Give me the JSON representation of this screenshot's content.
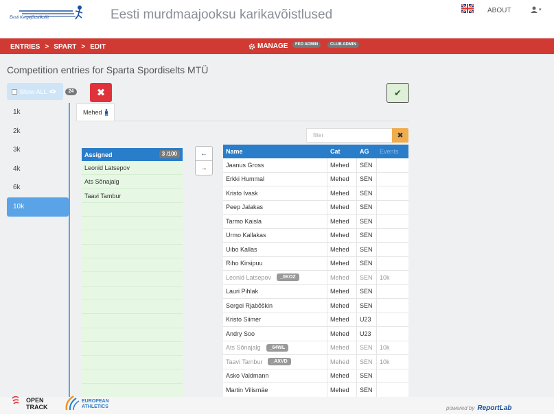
{
  "header": {
    "logo_caption": "Eesti Kergejõustikuliit",
    "title": "Eesti murdmaajooksu karikavõistlused",
    "about": "ABOUT",
    "user_caret": "▾"
  },
  "nav": {
    "crumbs": [
      "ENTRIES",
      "SPART",
      "EDIT"
    ],
    "sep": ">",
    "manage": "MANAGE",
    "badges": [
      "FED ADMIN",
      "CLUB ADMIN"
    ]
  },
  "page": {
    "heading": "Competition entries for Sparta Spordiselts MTÜ",
    "show_all": "Show ALL",
    "count": "24",
    "delete_glyph": "✖",
    "confirm_glyph": "✔"
  },
  "distances": [
    {
      "label": "1k",
      "active": false
    },
    {
      "label": "2k",
      "active": false
    },
    {
      "label": "3k",
      "active": false
    },
    {
      "label": "4k",
      "active": false
    },
    {
      "label": "6k",
      "active": false
    },
    {
      "label": "10k",
      "active": true
    }
  ],
  "tab": {
    "label": "Mehed"
  },
  "filter": {
    "placeholder": "filter",
    "button": "✖"
  },
  "assigned": {
    "header": "Assigned",
    "capacity": "3 /100",
    "rows": [
      "Leonid Latsepov",
      "Ats Sõnajalg",
      "Taavi Tambur",
      "",
      "",
      "",
      "",
      "",
      "",
      "",
      "",
      "",
      "",
      "",
      "",
      "",
      ""
    ]
  },
  "arrows": {
    "left": "←",
    "right": "→"
  },
  "table": {
    "columns": [
      "Name",
      "Cat",
      "AG",
      "Events"
    ],
    "rows": [
      {
        "name": "Jaanus Gross",
        "tag": "",
        "cat": "Mehed",
        "ag": "SEN",
        "events": "",
        "dim": false
      },
      {
        "name": "Erkki Hummal",
        "tag": "",
        "cat": "Mehed",
        "ag": "SEN",
        "events": "",
        "dim": false
      },
      {
        "name": "Kristo Ivask",
        "tag": "",
        "cat": "Mehed",
        "ag": "SEN",
        "events": "",
        "dim": false
      },
      {
        "name": "Peep Jalakas",
        "tag": "",
        "cat": "Mehed",
        "ag": "SEN",
        "events": "",
        "dim": false
      },
      {
        "name": "Tarmo Kaisla",
        "tag": "",
        "cat": "Mehed",
        "ag": "SEN",
        "events": "",
        "dim": false
      },
      {
        "name": "Urmo Kallakas",
        "tag": "",
        "cat": "Mehed",
        "ag": "SEN",
        "events": "",
        "dim": false
      },
      {
        "name": "Uibo Kallas",
        "tag": "",
        "cat": "Mehed",
        "ag": "SEN",
        "events": "",
        "dim": false
      },
      {
        "name": "Riho Kirsipuu",
        "tag": "",
        "cat": "Mehed",
        "ag": "SEN",
        "events": "",
        "dim": false
      },
      {
        "name": "Leonid Latsepov",
        "tag": "_0KOZ",
        "cat": "Mehed",
        "ag": "SEN",
        "events": "10k",
        "dim": true
      },
      {
        "name": "Lauri Pihlak",
        "tag": "",
        "cat": "Mehed",
        "ag": "SEN",
        "events": "",
        "dim": false
      },
      {
        "name": "Sergei Rjabõškin",
        "tag": "",
        "cat": "Mehed",
        "ag": "SEN",
        "events": "",
        "dim": false
      },
      {
        "name": "Kristo Siimer",
        "tag": "",
        "cat": "Mehed",
        "ag": "U23",
        "events": "",
        "dim": false
      },
      {
        "name": "Andry Soo",
        "tag": "",
        "cat": "Mehed",
        "ag": "U23",
        "events": "",
        "dim": false
      },
      {
        "name": "Ats Sõnajalg",
        "tag": "_64WL",
        "cat": "Mehed",
        "ag": "SEN",
        "events": "10k",
        "dim": true
      },
      {
        "name": "Taavi Tambur",
        "tag": "_AXVD",
        "cat": "Mehed",
        "ag": "SEN",
        "events": "10k",
        "dim": true
      },
      {
        "name": "Asko Valdmann",
        "tag": "",
        "cat": "Mehed",
        "ag": "SEN",
        "events": "",
        "dim": false
      },
      {
        "name": "Martin Vilismäe",
        "tag": "",
        "cat": "Mehed",
        "ag": "SEN",
        "events": "",
        "dim": false
      },
      {
        "name": "",
        "tag": "",
        "cat": "",
        "ag": "",
        "events": "",
        "dim": false
      }
    ]
  },
  "footer": {
    "opentrack_1": "OPEN",
    "opentrack_2": "TRACK",
    "european_1": "EUROPEAN",
    "european_2": "ATHLETICS",
    "powered": "powered by",
    "brand": "ReportLab"
  }
}
